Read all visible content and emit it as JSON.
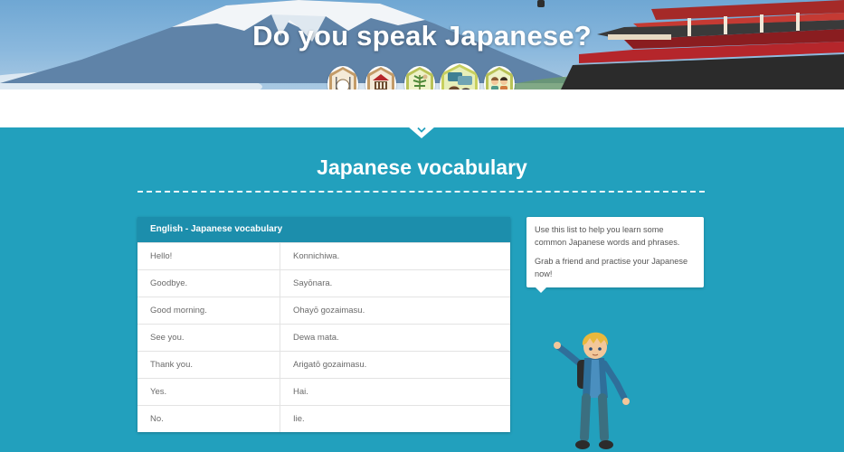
{
  "hero": {
    "title": "Do you speak Japanese?",
    "badges": [
      {
        "name": "food-badge-icon",
        "ring": "#c39b68",
        "inner": "#f4ead8"
      },
      {
        "name": "culture-badge-icon",
        "ring": "#c39b68",
        "inner": "#f4ead8"
      },
      {
        "name": "nature-badge-icon",
        "ring": "#b9c257",
        "inner": "#eef2c7"
      },
      {
        "name": "language-badge-icon",
        "ring": "#c7cf5e",
        "inner": "#e7efb9"
      },
      {
        "name": "family-badge-icon",
        "ring": "#b9c257",
        "inner": "#eef2c7"
      }
    ]
  },
  "section": {
    "title": "Japanese vocabulary"
  },
  "vocab": {
    "header": "English - Japanese vocabulary",
    "rows": [
      {
        "en": "Hello!",
        "jp": "Konnichiwa."
      },
      {
        "en": "Goodbye.",
        "jp": "Sayōnara."
      },
      {
        "en": "Good morning.",
        "jp": "Ohayō gozaimasu."
      },
      {
        "en": "See you.",
        "jp": "Dewa mata."
      },
      {
        "en": "Thank you.",
        "jp": "Arigatō gozaimasu."
      },
      {
        "en": "Yes.",
        "jp": "Hai."
      },
      {
        "en": "No.",
        "jp": "Iie."
      }
    ]
  },
  "note": {
    "paragraphs": [
      "Use this list to help you learn some common Japanese words and phrases.",
      "Grab a friend and practise your Japanese now!"
    ]
  },
  "colors": {
    "section_bg": "#22a0bd",
    "table_header": "#1c8eac",
    "pagoda_red": "#b5262b"
  }
}
